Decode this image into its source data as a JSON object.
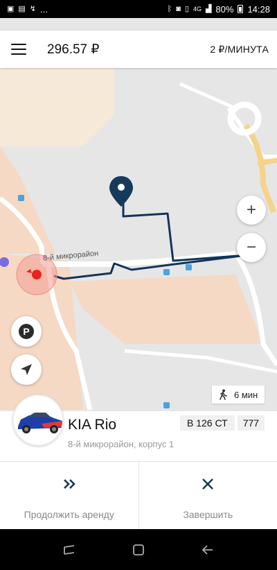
{
  "status_bar": {
    "time": "14:28",
    "battery": "80%",
    "network": "4G",
    "more": "..."
  },
  "header": {
    "menu_icon": "hamburger-icon",
    "balance": "296.57 ₽",
    "rate": "2 ₽/МИНУТА"
  },
  "map": {
    "street_label": "8-й микрорайон",
    "zoom_in_label": "+",
    "zoom_out_label": "−",
    "parking_label": "P",
    "walk_time": "6 мин",
    "colors": {
      "route": "#12345a",
      "pin": "#163a5c",
      "user_marker": "#e8241f"
    }
  },
  "car": {
    "name": "KIA Rio",
    "address": "8-й микрорайон, корпус 1",
    "plate_number": "В 126 СТ",
    "plate_region": "777"
  },
  "actions": {
    "continue": {
      "label": "Продолжить аренду",
      "icon": "double-chevron-right-icon"
    },
    "finish": {
      "label": "Завершить",
      "icon": "close-icon"
    }
  }
}
